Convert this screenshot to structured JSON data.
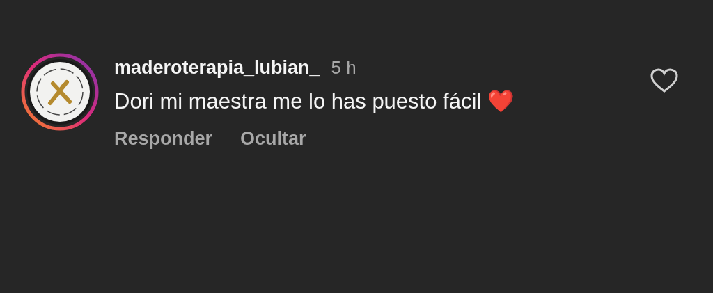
{
  "comment": {
    "username": "maderoterapia_lubian_",
    "time": "5 h",
    "text": "Dori mi maestra me lo has puesto fácil ❤️",
    "liked": false,
    "actions": [
      "Responder",
      "Ocultar"
    ]
  }
}
